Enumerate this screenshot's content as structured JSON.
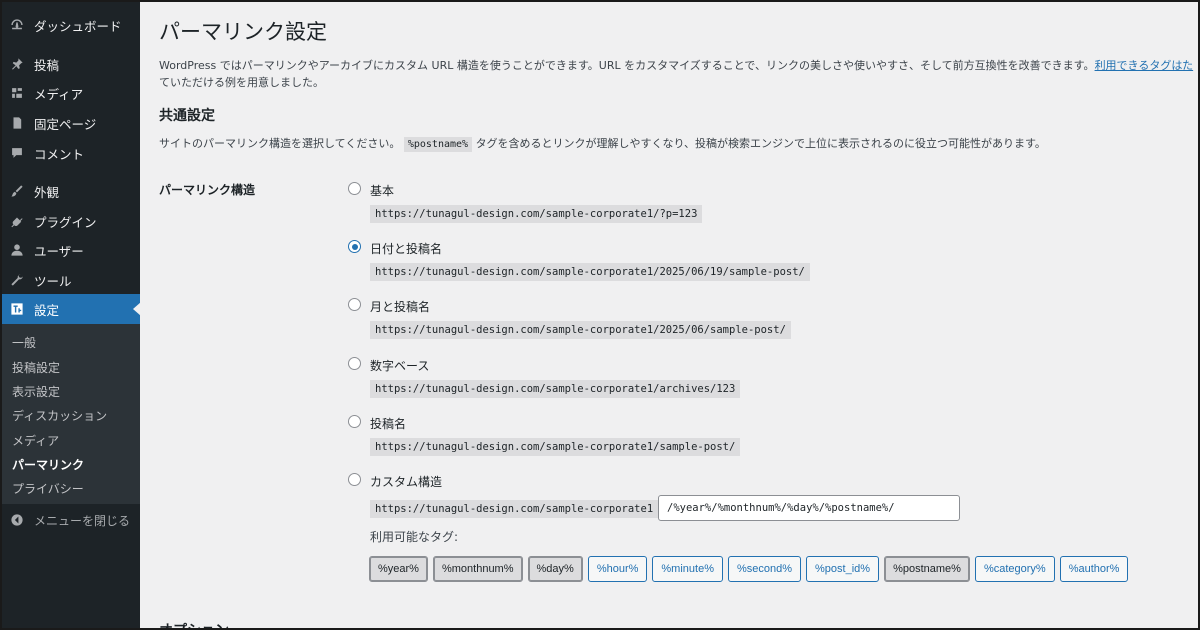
{
  "sidebar": {
    "items": [
      {
        "label": "ダッシュボード",
        "icon": "dashboard-icon"
      },
      {
        "label": "投稿",
        "icon": "pin-icon"
      },
      {
        "label": "メディア",
        "icon": "media-icon"
      },
      {
        "label": "固定ページ",
        "icon": "page-icon"
      },
      {
        "label": "コメント",
        "icon": "comment-icon"
      },
      {
        "label": "外観",
        "icon": "brush-icon"
      },
      {
        "label": "プラグイン",
        "icon": "plugin-icon"
      },
      {
        "label": "ユーザー",
        "icon": "user-icon"
      },
      {
        "label": "ツール",
        "icon": "wrench-icon"
      },
      {
        "label": "設定",
        "icon": "settings-icon"
      }
    ],
    "submenu": [
      "一般",
      "投稿設定",
      "表示設定",
      "ディスカッション",
      "メディア",
      "パーマリンク",
      "プライバシー"
    ],
    "collapse_label": "メニューを閉じる"
  },
  "main": {
    "title": "パーマリンク設定",
    "intro_text": "WordPress ではパーマリンクやアーカイブにカスタム URL 構造を使うことができます。URL をカスタマイズすることで、リンクの美しさや使いやすさ、そして前方互換性を改善できます。",
    "intro_link": "利用できるタグはた",
    "intro_text2": "ていただける例を用意しました。",
    "common_title": "共通設定",
    "common_desc_before": "サイトのパーマリンク構造を選択してください。",
    "common_desc_code": "%postname%",
    "common_desc_after": "タグを含めるとリンクが理解しやすくなり、投稿が検索エンジンで上位に表示されるのに役立つ可能性があります。",
    "structure_label": "パーマリンク構造",
    "options": [
      {
        "label": "基本",
        "example": "https://tunagul-design.com/sample-corporate1/?p=123",
        "checked": false
      },
      {
        "label": "日付と投稿名",
        "example": "https://tunagul-design.com/sample-corporate1/2025/06/19/sample-post/",
        "checked": true
      },
      {
        "label": "月と投稿名",
        "example": "https://tunagul-design.com/sample-corporate1/2025/06/sample-post/",
        "checked": false
      },
      {
        "label": "数字ベース",
        "example": "https://tunagul-design.com/sample-corporate1/archives/123",
        "checked": false
      },
      {
        "label": "投稿名",
        "example": "https://tunagul-design.com/sample-corporate1/sample-post/",
        "checked": false
      },
      {
        "label": "カスタム構造",
        "example": "https://tunagul-design.com/sample-corporate1",
        "checked": false
      }
    ],
    "custom_value": "/%year%/%monthnum%/%day%/%postname%/",
    "tags_label": "利用可能なタグ:",
    "tags": [
      {
        "label": "%year%",
        "selected": true
      },
      {
        "label": "%monthnum%",
        "selected": true
      },
      {
        "label": "%day%",
        "selected": true
      },
      {
        "label": "%hour%",
        "selected": false
      },
      {
        "label": "%minute%",
        "selected": false
      },
      {
        "label": "%second%",
        "selected": false
      },
      {
        "label": "%post_id%",
        "selected": false
      },
      {
        "label": "%postname%",
        "selected": true
      },
      {
        "label": "%category%",
        "selected": false
      },
      {
        "label": "%author%",
        "selected": false
      }
    ],
    "options_heading": "オプション"
  },
  "colors": {
    "sidebar_bg": "#1d2327",
    "accent": "#2271b1",
    "page_bg": "#f0f0f1"
  }
}
